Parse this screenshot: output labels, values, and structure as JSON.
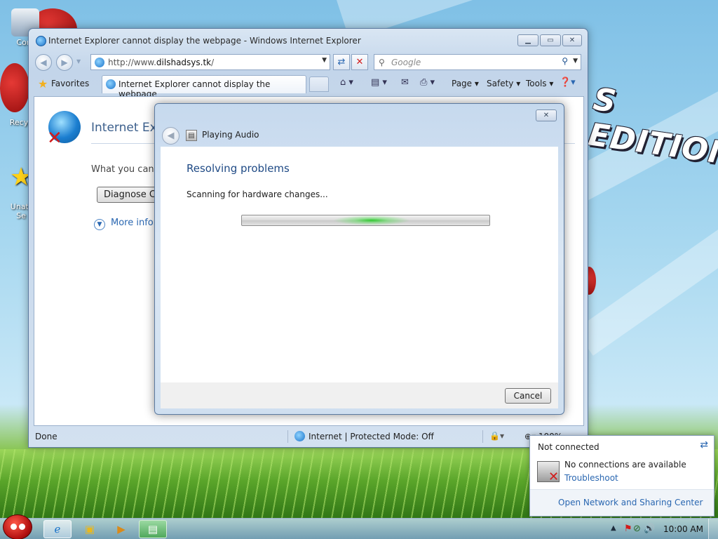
{
  "desktop": {
    "wallpaper_text": "S EDITION",
    "icons": [
      {
        "label": "Com"
      },
      {
        "label": "Recyc"
      },
      {
        "label": "Unatt\nSe"
      }
    ]
  },
  "ie": {
    "title": "Internet Explorer cannot display the webpage - Windows Internet Explorer",
    "address_prefix": "http://www.",
    "address_domain": "dilshadsys.tk",
    "address_suffix": "/",
    "search_placeholder": "Google",
    "favorites_label": "Favorites",
    "tab_label": "Internet Explorer cannot display the webpage",
    "commands": {
      "page": "Page ▾",
      "safety": "Safety ▾",
      "tools": "Tools ▾"
    },
    "content": {
      "title": "Internet Exp",
      "question": "What you can t",
      "diagnose_button": "Diagnose Co",
      "more_info": "More infor"
    },
    "status": {
      "text": "Done",
      "zone": "Internet | Protected Mode: Off",
      "zoom": "100%"
    }
  },
  "dialog": {
    "title": "Playing Audio",
    "heading": "Resolving problems",
    "status": "Scanning for hardware changes...",
    "cancel_label": "Cancel"
  },
  "network_popup": {
    "header": "Not connected",
    "message": "No connections are available",
    "troubleshoot_link": "Troubleshoot",
    "center_link": "Open Network and Sharing Center"
  },
  "taskbar": {
    "clock": "10:00 AM"
  },
  "colors": {
    "accent_blue": "#1f4a85",
    "link_blue": "#2a67b1",
    "progress_green": "#28c828",
    "error_red": "#d21b1b"
  },
  "icons": {
    "back": "back-arrow-icon",
    "forward": "forward-arrow-icon",
    "refresh": "refresh-icon",
    "stop": "stop-icon",
    "search": "magnifier-icon",
    "favorites": "star-icon",
    "home": "home-icon",
    "feeds": "rss-icon",
    "mail": "mail-icon",
    "print": "printer-icon",
    "help": "help-icon"
  }
}
